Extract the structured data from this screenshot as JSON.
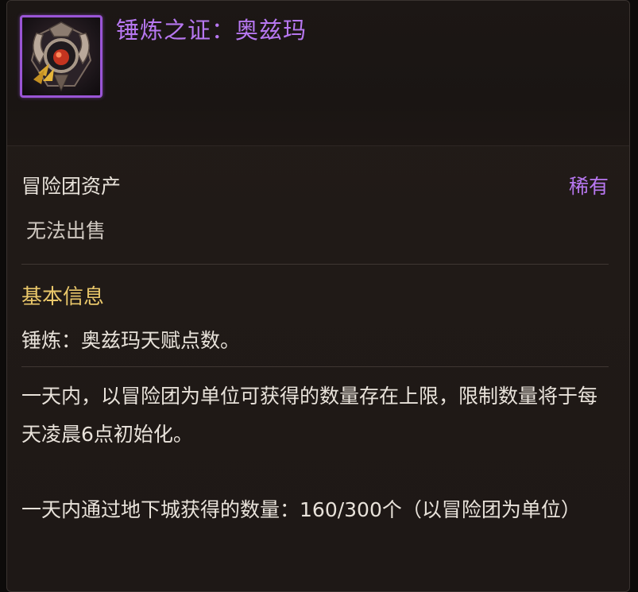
{
  "item": {
    "icon_name": "hammer-crest-emblem-icon",
    "title": "锤炼之证：奥兹玛",
    "rarity_color": "#b777f0"
  },
  "meta": {
    "category": "冒险团资产",
    "rarity": "稀有",
    "sell_status": "无法出售"
  },
  "basic_info": {
    "heading": "基本信息",
    "description": "锤炼：奥兹玛天赋点数。"
  },
  "limits": {
    "daily_limit_text": "一天内，以冒险团为单位可获得的数量存在上限，限制数量将于每天凌晨6点初始化。",
    "dungeon_count_text": "一天内通过地下城获得的数量：160/300个（以冒险团为单位）"
  }
}
